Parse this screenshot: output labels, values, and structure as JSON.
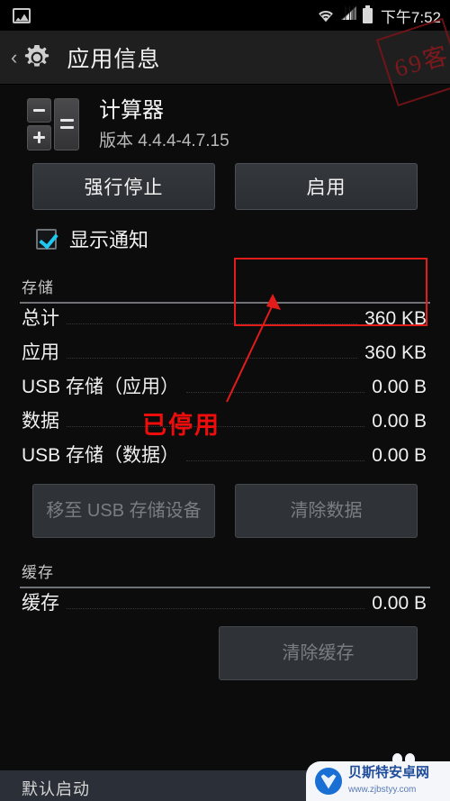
{
  "statusbar": {
    "left_icon": "image-icon",
    "icons": [
      "wifi-icon",
      "signal-icon",
      "battery-icon"
    ],
    "time": "下午7:52"
  },
  "actionbar": {
    "back_label": "‹",
    "icon": "gear-icon",
    "title": "应用信息"
  },
  "stamp": {
    "text": "6 9 客"
  },
  "app": {
    "icon": "calculator-icon",
    "name": "计算器",
    "version": "版本 4.4.4-4.7.15"
  },
  "actions": {
    "force_stop": "强行停止",
    "enable": "启用"
  },
  "notifications": {
    "label": "显示通知",
    "checked": true
  },
  "storage": {
    "section_title": "存储",
    "rows": [
      {
        "label": "总计",
        "value": "360 KB"
      },
      {
        "label": "应用",
        "value": "360 KB"
      },
      {
        "label": "USB 存储（应用）",
        "value": "0.00 B"
      },
      {
        "label": "数据",
        "value": "0.00 B"
      },
      {
        "label": "USB 存储（数据）",
        "value": "0.00 B"
      }
    ],
    "move_to_usb": "移至 USB 存储设备",
    "clear_data": "清除数据"
  },
  "cache": {
    "section_title": "缓存",
    "row": {
      "label": "缓存",
      "value": "0.00 B"
    },
    "clear_cache": "清除缓存"
  },
  "default_launch": {
    "section_title": "默认启动"
  },
  "annotation": {
    "disabled_text": "已停用",
    "color": "#f10c0c",
    "highlight_color": "#e21b1b"
  },
  "watermark": {
    "name": "贝斯特安卓网",
    "url": "www.zjbstyy.com"
  }
}
